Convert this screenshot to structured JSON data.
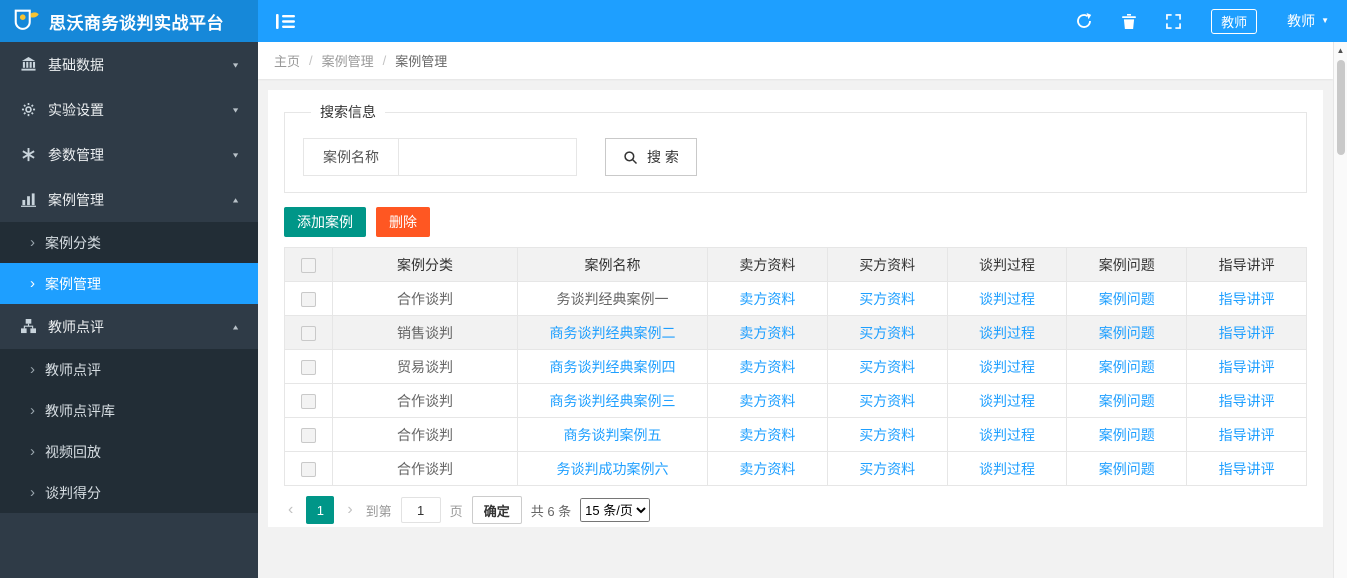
{
  "app": {
    "title": "思沃商务谈判实战平台",
    "role_badge": "教师",
    "user_name": "教师"
  },
  "sidebar": {
    "items": [
      {
        "label": "基础数据",
        "icon": "bank-icon",
        "expanded": false,
        "children": []
      },
      {
        "label": "实验设置",
        "icon": "gears-icon",
        "expanded": false,
        "children": []
      },
      {
        "label": "参数管理",
        "icon": "asterisk-icon",
        "expanded": false,
        "children": []
      },
      {
        "label": "案例管理",
        "icon": "bar-chart-icon",
        "expanded": true,
        "children": [
          {
            "label": "案例分类",
            "active": false
          },
          {
            "label": "案例管理",
            "active": true
          }
        ]
      },
      {
        "label": "教师点评",
        "icon": "sitemap-icon",
        "expanded": true,
        "children": [
          {
            "label": "教师点评",
            "active": false
          },
          {
            "label": "教师点评库",
            "active": false
          },
          {
            "label": "视频回放",
            "active": false
          },
          {
            "label": "谈判得分",
            "active": false
          }
        ]
      }
    ]
  },
  "breadcrumb": {
    "items": [
      "主页",
      "案例管理",
      "案例管理"
    ],
    "separator": "/"
  },
  "search": {
    "legend": "搜索信息",
    "field_label": "案例名称",
    "input_value": "",
    "button_label": "搜 索"
  },
  "toolbar": {
    "add_label": "添加案例",
    "delete_label": "删除"
  },
  "table": {
    "headers": [
      "案例分类",
      "案例名称",
      "卖方资料",
      "买方资料",
      "谈判过程",
      "案例问题",
      "指导讲评"
    ],
    "link_columns": [
      "卖方资料",
      "买方资料",
      "谈判过程",
      "案例问题",
      "指导讲评"
    ],
    "rows": [
      {
        "category": "合作谈判",
        "name": "务谈判经典案例一",
        "name_is_link": false,
        "shaded": false
      },
      {
        "category": "销售谈判",
        "name": "商务谈判经典案例二",
        "name_is_link": true,
        "shaded": true
      },
      {
        "category": "贸易谈判",
        "name": "商务谈判经典案例四",
        "name_is_link": true,
        "shaded": false
      },
      {
        "category": "合作谈判",
        "name": "商务谈判经典案例三",
        "name_is_link": true,
        "shaded": false
      },
      {
        "category": "合作谈判",
        "name": "商务谈判案例五",
        "name_is_link": true,
        "shaded": false
      },
      {
        "category": "合作谈判",
        "name": "务谈判成功案例六",
        "name_is_link": true,
        "shaded": false
      }
    ]
  },
  "pagination": {
    "prev": "‹",
    "current_page": "1",
    "next": "›",
    "goto_prefix": "到第",
    "goto_value": "1",
    "goto_suffix": "页",
    "confirm_label": "确定",
    "total_label": "共 6 条",
    "page_size_option": "15 条/页"
  },
  "colors": {
    "topbar_blue": "#1E9FFF",
    "logo_blue": "#1688d9",
    "sidebar_dark": "#2F3B47",
    "sidebar_sub_dark": "#222D36",
    "active_blue": "#1E9FFF",
    "link_blue": "#1E9FFF",
    "add_green": "#009688",
    "delete_orange": "#FF5722",
    "pagination_green": "#009688"
  }
}
